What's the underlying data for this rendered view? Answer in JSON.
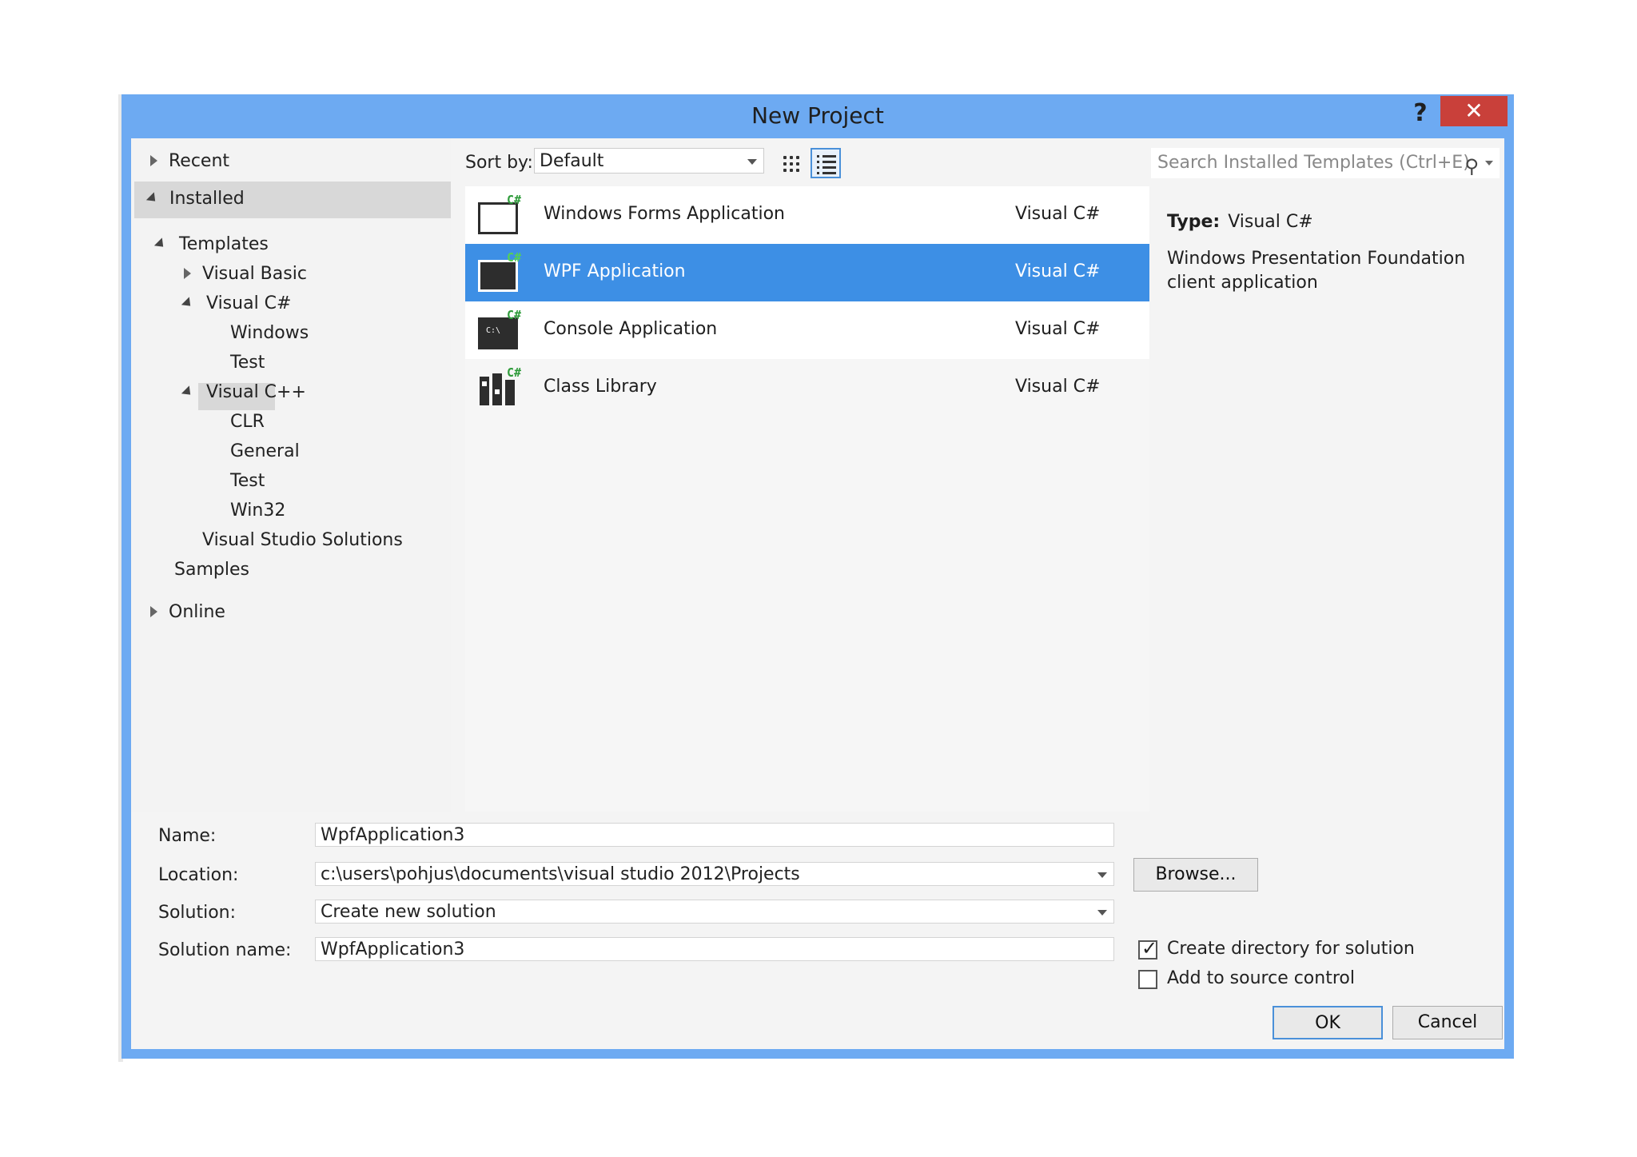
{
  "dialog": {
    "title": "New Project",
    "help_label": "?",
    "close_label": "✕"
  },
  "tree": {
    "recent": "Recent",
    "installed": "Installed",
    "templates": "Templates",
    "visual_basic": "Visual Basic",
    "visual_csharp": "Visual C#",
    "cs_windows": "Windows",
    "cs_test": "Test",
    "visual_cpp": "Visual C++",
    "cpp_clr": "CLR",
    "cpp_general": "General",
    "cpp_test": "Test",
    "cpp_win32": "Win32",
    "vs_solutions": "Visual Studio Solutions",
    "samples": "Samples",
    "online": "Online"
  },
  "toolbar": {
    "sort_label": "Sort by:",
    "sort_value": "Default"
  },
  "search": {
    "placeholder": "Search Installed Templates (Ctrl+E)"
  },
  "projects": [
    {
      "name": "Windows Forms Application",
      "lang": "Visual C#",
      "icon": "winforms-icon"
    },
    {
      "name": "WPF Application",
      "lang": "Visual C#",
      "icon": "wpf-icon",
      "selected": true
    },
    {
      "name": "Console Application",
      "lang": "Visual C#",
      "icon": "console-icon"
    },
    {
      "name": "Class Library",
      "lang": "Visual C#",
      "icon": "class-library-icon"
    }
  ],
  "icon_badge": "C#",
  "console_icon_text": "C:\\",
  "details": {
    "type_label": "Type:",
    "type_value": "Visual C#",
    "description": "Windows Presentation Foundation client application"
  },
  "form": {
    "name_label": "Name:",
    "name_value": "WpfApplication3",
    "location_label": "Location:",
    "location_value": "c:\\users\\pohjus\\documents\\visual studio 2012\\Projects",
    "solution_label": "Solution:",
    "solution_value": "Create new solution",
    "solution_name_label": "Solution name:",
    "solution_name_value": "WpfApplication3",
    "browse_label": "Browse...",
    "create_dir_label": "Create directory for solution",
    "create_dir_checked": true,
    "source_control_label": "Add to source control",
    "source_control_checked": false,
    "ok_label": "OK",
    "cancel_label": "Cancel"
  },
  "colors": {
    "frame": "#6daaf2",
    "selection": "#3d8fe5",
    "close": "#c9403a"
  }
}
